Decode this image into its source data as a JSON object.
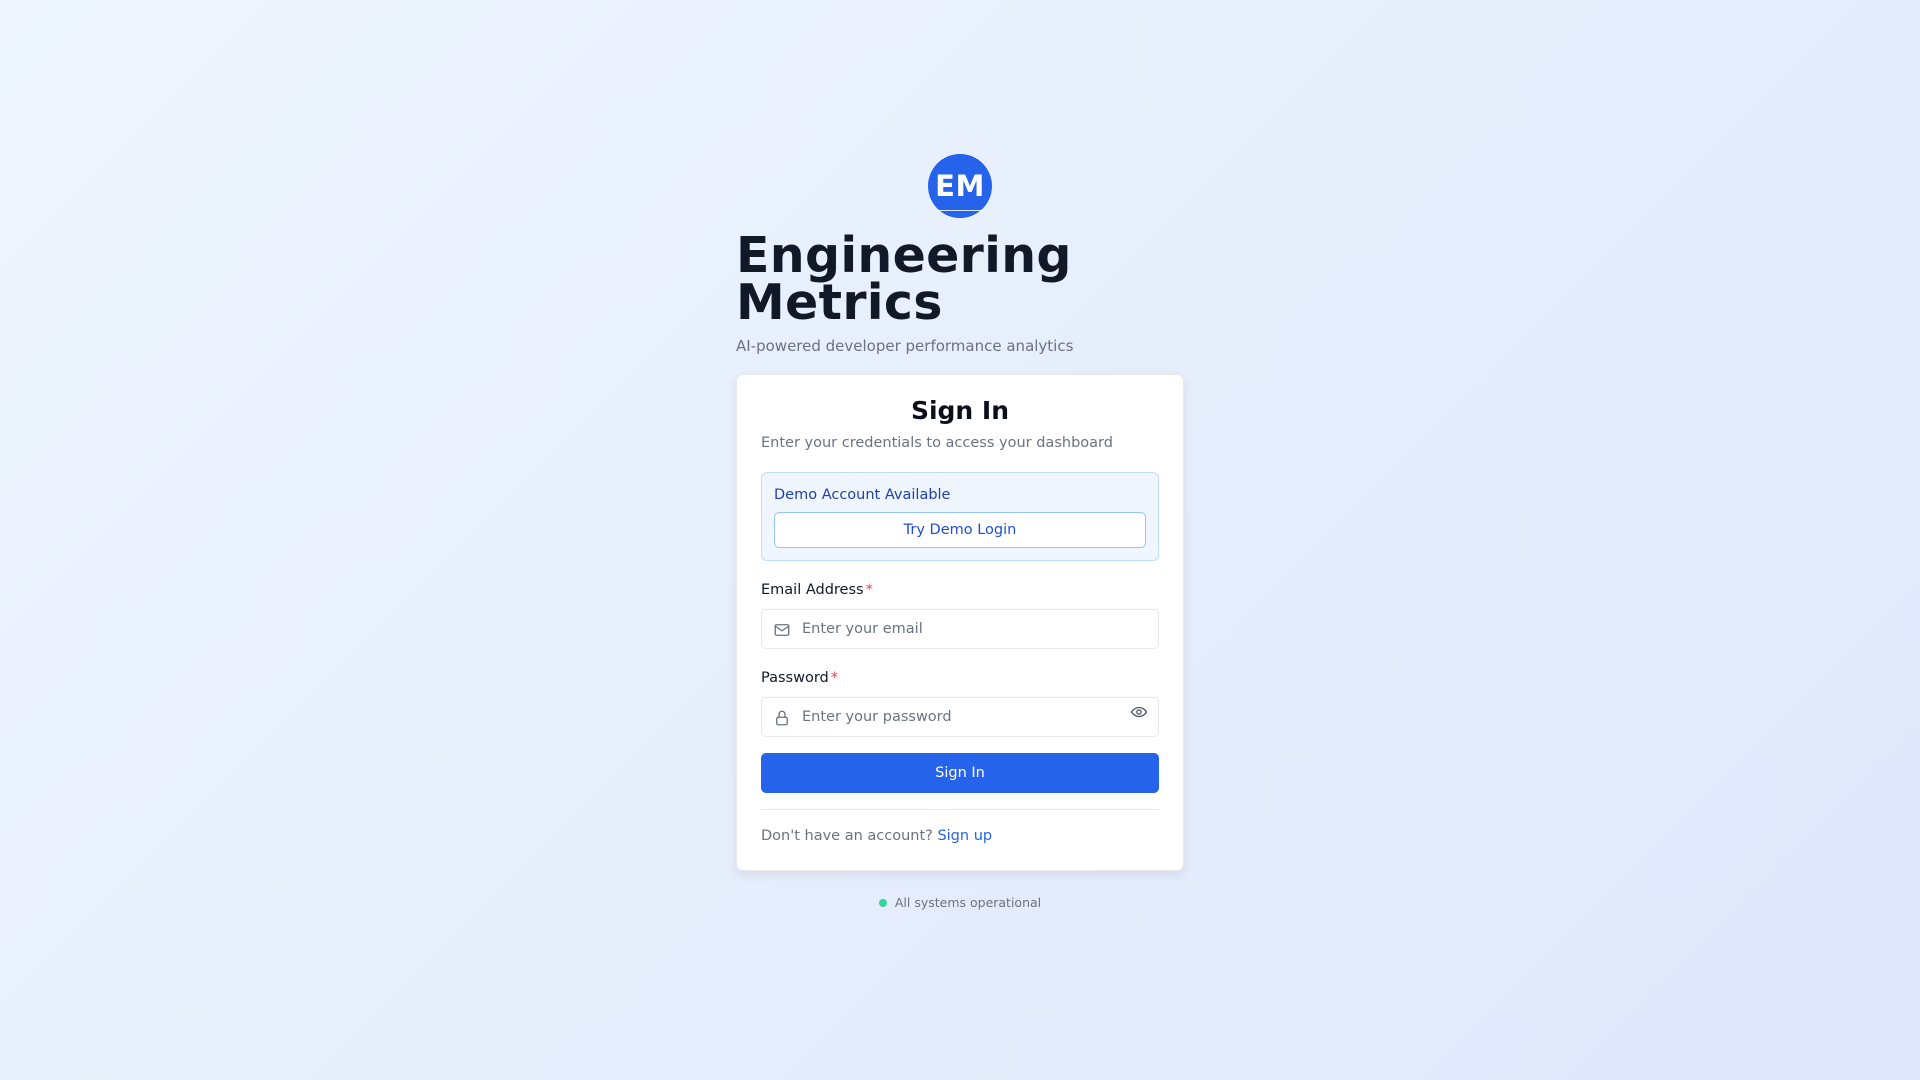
{
  "brand": {
    "logo_text": "EM",
    "title_line1": "Engineering",
    "title_line2": "Metrics",
    "subtitle": "AI-powered developer performance analytics"
  },
  "card": {
    "title": "Sign In",
    "subtitle": "Enter your credentials to access your dashboard",
    "demo": {
      "label": "Demo Account Available",
      "button_label": "Try Demo Login"
    },
    "email": {
      "label": "Email Address",
      "required_mark": "*",
      "value": "",
      "placeholder": "Enter your email",
      "icon": "mail-icon"
    },
    "password": {
      "label": "Password",
      "required_mark": "*",
      "value": "",
      "placeholder": "Enter your password",
      "icon": "lock-icon",
      "toggle_icon": "eye-icon"
    },
    "submit_label": "Sign In",
    "signup_prompt": "Don't have an account?",
    "signup_link": "Sign up"
  },
  "status": {
    "text": "All systems operational",
    "color": "#34d399"
  },
  "colors": {
    "accent": "#2563eb",
    "required": "#ef4444",
    "demo_bg": "#eff6ff",
    "demo_border": "#bfdbfe"
  }
}
